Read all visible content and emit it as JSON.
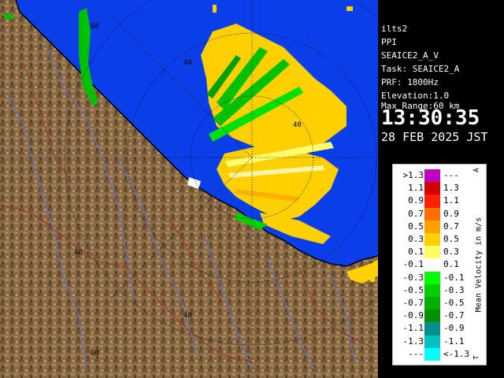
{
  "info": {
    "station": "ilts2",
    "product": "PPI",
    "scan": "SEAICE2_A_V",
    "task": "Task: SEAICE2_A",
    "prf": "PRF: 1800Hz",
    "elevation": "Elevation:1.0",
    "max_range": "Max Range:60 km",
    "time": "13:30:35",
    "date": "28 FEB 2025 JST"
  },
  "range_rings": {
    "labels": [
      "60",
      "40",
      "40",
      "40",
      "40",
      "60"
    ]
  },
  "legend": {
    "title": "Mean Velocity in m/s",
    "corner_top": "A",
    "corner_bottom": "T",
    "rows": [
      {
        "left": ">1.3",
        "right": "---",
        "color": "#c000c0"
      },
      {
        "left": "1.1",
        "right": "1.3",
        "color": "#d00000"
      },
      {
        "left": "0.9",
        "right": "1.1",
        "color": "#ff2000"
      },
      {
        "left": "0.7",
        "right": "0.9",
        "color": "#ff7000"
      },
      {
        "left": "0.5",
        "right": "0.7",
        "color": "#ffa000"
      },
      {
        "left": "0.3",
        "right": "0.5",
        "color": "#ffd000"
      },
      {
        "left": "0.1",
        "right": "0.3",
        "color": "#ffff60"
      },
      {
        "left": "-0.1",
        "right": "0.1",
        "color": "#ffffff"
      },
      {
        "left": "-0.3",
        "right": "-0.1",
        "color": "#00ff00"
      },
      {
        "left": "-0.5",
        "right": "-0.3",
        "color": "#00d000"
      },
      {
        "left": "-0.7",
        "right": "-0.5",
        "color": "#00b000"
      },
      {
        "left": "-0.9",
        "right": "-0.7",
        "color": "#009000"
      },
      {
        "left": "-1.1",
        "right": "-0.9",
        "color": "#009090"
      },
      {
        "left": "-1.3",
        "right": "-1.1",
        "color": "#00c0c0"
      },
      {
        "left": "---",
        "right": "<-1.3",
        "color": "#00ffff"
      }
    ]
  },
  "colors": {
    "sea": "#0a3ee8",
    "land": "#8a6a45",
    "coast": "#000000",
    "rivers": "#6070d0",
    "boundaries": "#a03030"
  }
}
